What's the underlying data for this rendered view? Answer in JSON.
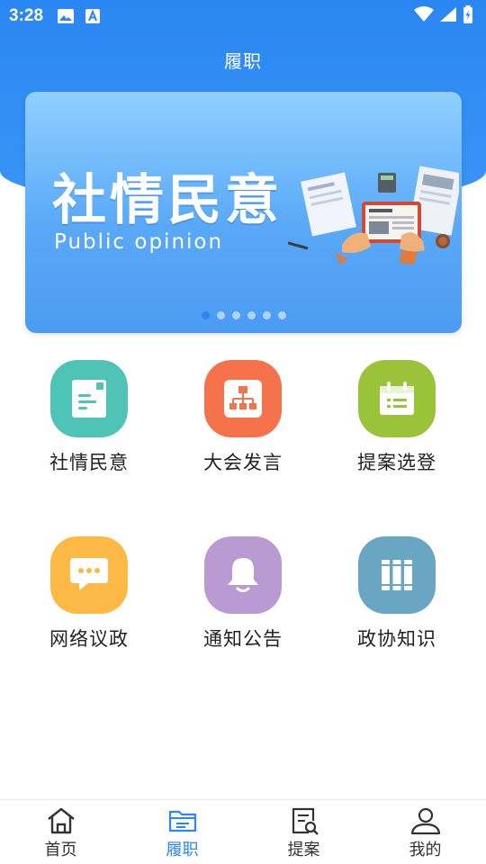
{
  "status_bar": {
    "time": "3:28",
    "left_icons": [
      "image-icon",
      "font-download-icon"
    ],
    "right_icons": [
      "wifi-icon",
      "signal-icon",
      "battery-icon"
    ]
  },
  "header": {
    "title": "履职"
  },
  "banner": {
    "title": "社情民意",
    "subtitle": "Public opinion",
    "slide_count": 6,
    "active_slide": 1
  },
  "tiles": [
    {
      "label": "社情民意",
      "icon": "document-icon",
      "color": "#4fc3b5"
    },
    {
      "label": "大会发言",
      "icon": "org-chart-icon",
      "color": "#f6724b"
    },
    {
      "label": "提案选登",
      "icon": "calendar-icon",
      "color": "#9ac33a"
    },
    {
      "label": "网络议政",
      "icon": "chat-bubble-icon",
      "color": "#fcb945"
    },
    {
      "label": "通知公告",
      "icon": "bell-icon",
      "color": "#b99ad3"
    },
    {
      "label": "政协知识",
      "icon": "books-icon",
      "color": "#69a6c4"
    }
  ],
  "bottom_nav": {
    "active": "履职",
    "items": [
      {
        "label": "首页",
        "icon": "home-icon"
      },
      {
        "label": "履职",
        "icon": "folder-icon"
      },
      {
        "label": "提案",
        "icon": "document-search-icon"
      },
      {
        "label": "我的",
        "icon": "person-icon"
      }
    ]
  },
  "colors": {
    "primary": "#2a86f2",
    "text": "#222222"
  }
}
